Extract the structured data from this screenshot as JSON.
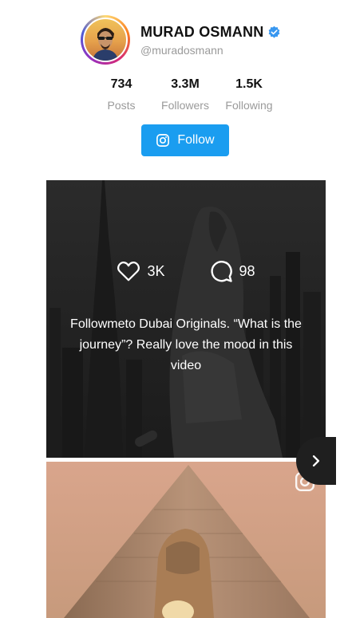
{
  "profile": {
    "name": "MURAD OSMANN",
    "handle": "@muradosmann",
    "verified": true
  },
  "stats": [
    {
      "value": "734",
      "label": "Posts"
    },
    {
      "value": "3.3M",
      "label": "Followers"
    },
    {
      "value": "1.5K",
      "label": "Following"
    }
  ],
  "follow_button": {
    "label": "Follow",
    "icon": "instagram-icon"
  },
  "posts": [
    {
      "likes": "3K",
      "comments": "98",
      "caption": "Followmeto Dubai Originals. “What is the journey”? Really love the mood in this video"
    }
  ],
  "colors": {
    "accent": "#1a9df0",
    "verified": "#3897f0"
  }
}
